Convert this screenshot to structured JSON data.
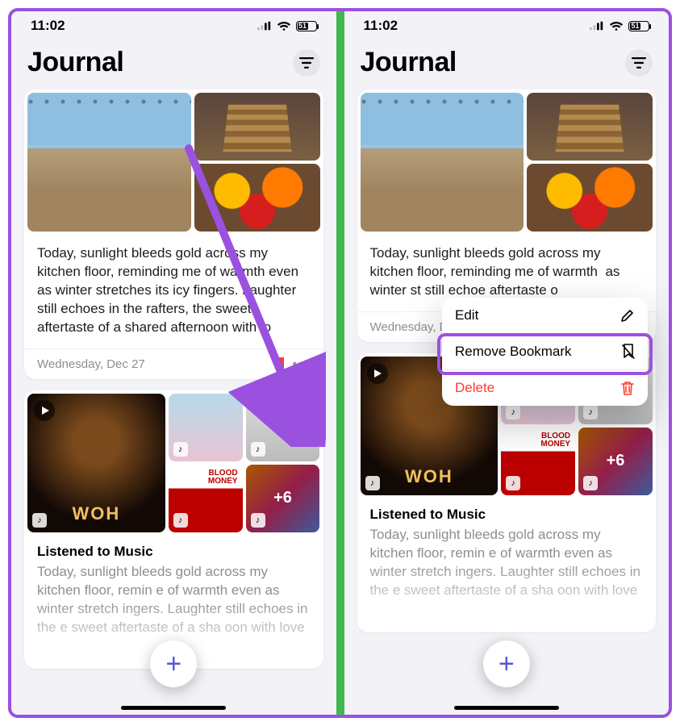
{
  "status": {
    "time": "11:02",
    "battery": "51"
  },
  "header": {
    "title": "Journal"
  },
  "entry": {
    "body": "Today, sunlight bleeds gold across my kitchen floor, reminding me of warmth even as winter stretches its icy fingers. Laughter still echoes in the rafters, the sweet aftertaste of a shared afternoon with lo",
    "body_truncated": "Today, sunlight bleeds gold across my kitchen floor, reminding me of warmth  as winter st still echoe aftertaste o",
    "date": "Wednesday, Dec 27"
  },
  "music": {
    "title": "Listened to Music",
    "body": "Today, sunlight bleeds gold across my kitchen floor, remin            e of warmth even as winter stretch                ingers. Laughter still echoes in the               e sweet aftertaste of a sha              oon with love",
    "overflow": "+6"
  },
  "menu": {
    "edit": "Edit",
    "remove_bookmark": "Remove Bookmark",
    "delete": "Delete"
  }
}
